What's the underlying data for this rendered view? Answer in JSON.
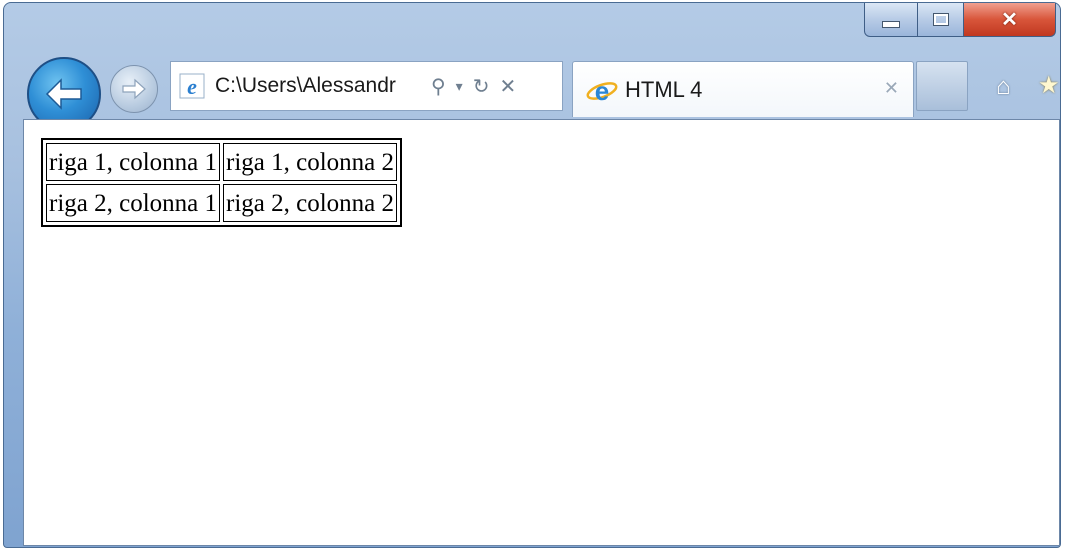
{
  "browser": {
    "address": "C:\\Users\\Alessandr",
    "tab_title": "HTML 4",
    "accent_colors": {
      "frame": "#a7c0df",
      "close": "#d8553a",
      "back": "#2f8fd6"
    }
  },
  "table": {
    "rows": [
      [
        "riga 1, colonna 1",
        "riga 1, colonna 2"
      ],
      [
        "riga 2, colonna 1",
        "riga 2, colonna 2"
      ]
    ]
  }
}
